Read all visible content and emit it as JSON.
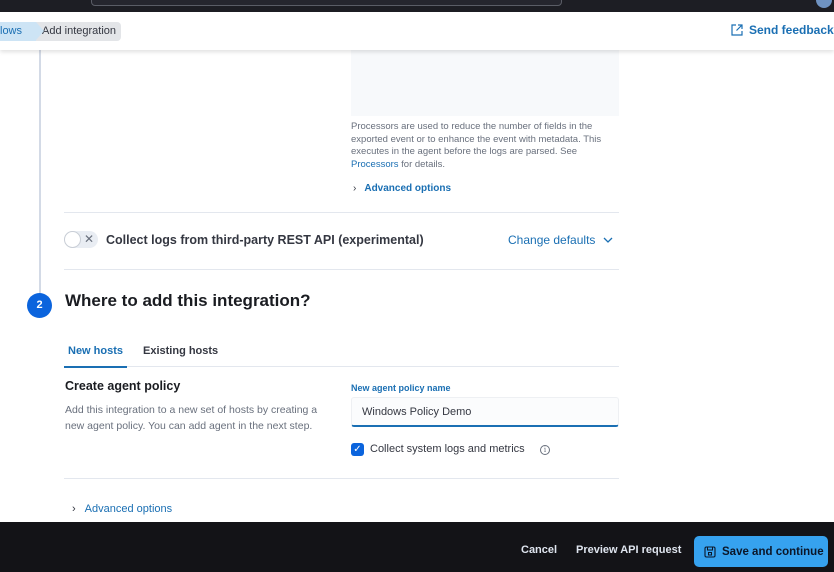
{
  "header": {
    "breadcrumbs": [
      "lows",
      "Add integration"
    ],
    "feedback_label": "Send feedback"
  },
  "processors": {
    "help_prefix": "Processors are used to reduce the number of fields in the exported event or to enhance the event with metadata. This executes in the agent before the logs are parsed. See ",
    "help_link": "Processors",
    "help_suffix": " for details.",
    "advanced_options": "Advanced options"
  },
  "rest_api_input": {
    "label": "Collect logs from third-party REST API (experimental)",
    "enabled": false,
    "change_defaults": "Change defaults"
  },
  "step2": {
    "number": "2",
    "title": "Where to add this integration?",
    "tabs": [
      {
        "label": "New hosts",
        "active": true
      },
      {
        "label": "Existing hosts",
        "active": false
      }
    ],
    "create_title": "Create agent policy",
    "create_desc": "Add this integration to a new set of hosts by creating a new agent policy. You can add agent in the next step.",
    "field_label": "New agent policy name",
    "field_value": "Windows Policy Demo",
    "checkbox_label": "Collect system logs and metrics",
    "checkbox_checked": true,
    "advanced_options": "Advanced options"
  },
  "footer": {
    "cancel": "Cancel",
    "preview": "Preview API request",
    "save": "Save and continue"
  },
  "colors": {
    "accent": "#1a6fb3",
    "primary_button": "#36a2ef",
    "step_badge": "#0b64dd"
  }
}
